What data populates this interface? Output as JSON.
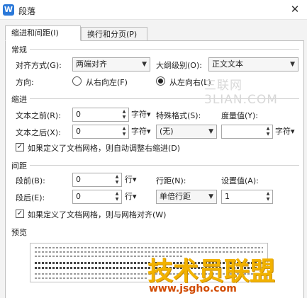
{
  "title": "段落",
  "tabs": [
    {
      "label": "缩进和间距(I)",
      "active": true
    },
    {
      "label": "换行和分页(P)",
      "active": false
    }
  ],
  "general": {
    "heading": "常规",
    "align_label": "对齐方式(G):",
    "align_value": "两端对齐",
    "outline_label": "大纲级别(O):",
    "outline_value": "正文文本",
    "direction_label": "方向:",
    "rtl_label": "从右向左(F)",
    "ltr_label": "从左向右(L)",
    "direction_selected": "ltr"
  },
  "indent": {
    "heading": "缩进",
    "before_label": "文本之前(R):",
    "before_value": "0",
    "before_unit": "字符▾",
    "after_label": "文本之后(X):",
    "after_value": "0",
    "after_unit": "字符▾",
    "special_label": "特殊格式(S):",
    "special_value": "(无)",
    "measure_label": "度量值(Y):",
    "measure_value": "",
    "measure_unit": "字符▾",
    "grid_checkbox_label": "如果定义了文档网格，则自动调整右缩进(D)",
    "grid_checked": true
  },
  "spacing": {
    "heading": "间距",
    "before_label": "段前(B):",
    "before_value": "0",
    "before_unit": "行▾",
    "after_label": "段后(E):",
    "after_value": "0",
    "after_unit": "行▾",
    "line_label": "行距(N):",
    "line_value": "单倍行距",
    "setting_label": "设置值(A):",
    "setting_value": "1",
    "grid_checkbox_label": "如果定义了文档网格，则与网格对齐(W)",
    "grid_checked": true
  },
  "preview": {
    "heading": "预览"
  },
  "watermarks": {
    "top": "三联网 3LIAN.COM",
    "logo": "技术员联盟",
    "url": "www.jsgho.com"
  },
  "icons": {
    "app": "wps-writer-icon",
    "close": "close-icon",
    "dropdown": "chevron-down-icon",
    "spinner": "spinner-icon",
    "check": "checkmark-icon"
  },
  "colors": {
    "app_icon": "#2b79d9",
    "watermark_logo": "#f2b200",
    "watermark_url": "#d14a00"
  }
}
